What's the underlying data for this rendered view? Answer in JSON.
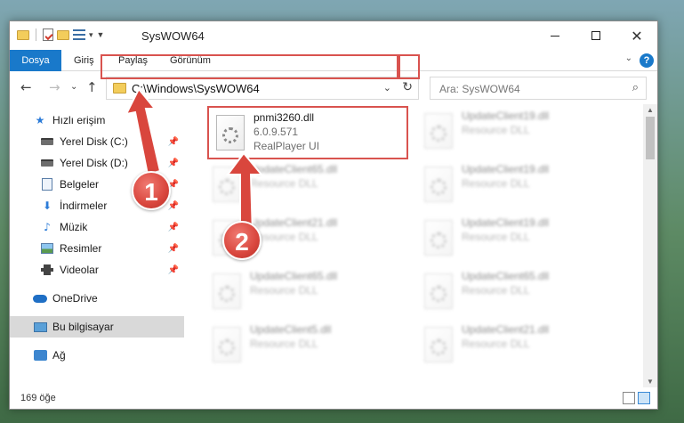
{
  "window": {
    "title": "SysWOW64",
    "controls": {
      "minimize": "—",
      "maximize": "□",
      "close": "✕"
    }
  },
  "ribbon": {
    "tabs": [
      {
        "label": "Dosya",
        "active": true
      },
      {
        "label": "Giriş"
      },
      {
        "label": "Paylaş"
      },
      {
        "label": "Görünüm"
      }
    ],
    "help": "?"
  },
  "nav": {
    "back": "←",
    "forward": "→",
    "dropdown": "⌄",
    "up": "↑",
    "address": "C:\\Windows\\SysWOW64",
    "refresh": "↻",
    "search_placeholder": "Ara: SysWOW64",
    "search_icon": "⌕"
  },
  "sidebar": {
    "items": [
      {
        "label": "Hızlı erişim",
        "icon": "star-icon"
      },
      {
        "label": "Yerel Disk (C:)",
        "icon": "drive-icon",
        "pinned": true
      },
      {
        "label": "Yerel Disk (D:)",
        "icon": "drive-icon",
        "pinned": true
      },
      {
        "label": "Belgeler",
        "icon": "documents-icon",
        "pinned": true
      },
      {
        "label": "İndirmeler",
        "icon": "download-icon",
        "pinned": true
      },
      {
        "label": "Müzik",
        "icon": "music-icon",
        "pinned": true
      },
      {
        "label": "Resimler",
        "icon": "pictures-icon",
        "pinned": true
      },
      {
        "label": "Videolar",
        "icon": "videos-icon",
        "pinned": true
      },
      {
        "label": "OneDrive",
        "icon": "cloud-icon"
      },
      {
        "label": "Bu bilgisayar",
        "icon": "computer-icon",
        "selected": true
      },
      {
        "label": "Ağ",
        "icon": "network-icon"
      }
    ]
  },
  "files": {
    "highlighted": {
      "name": "pnmi3260.dll",
      "version": "6.0.9.571",
      "desc": "RealPlayer UI"
    },
    "left_column": [
      {
        "name": "UpdateClient65.dll",
        "desc": "Resource DLL"
      },
      {
        "name": "UpdateClient21.dll",
        "desc": "Resource DLL"
      },
      {
        "name": "UpdateClient65.dll",
        "desc": "Resource DLL"
      },
      {
        "name": "UpdateClient5.dll",
        "desc": "Resource DLL"
      }
    ],
    "right_column": [
      {
        "name": "UpdateClient19.dll",
        "desc": "Resource DLL"
      },
      {
        "name": "UpdateClient19.dll",
        "desc": "Resource DLL"
      },
      {
        "name": "UpdateClient19.dll",
        "desc": "Resource DLL"
      },
      {
        "name": "UpdateClient65.dll",
        "desc": "Resource DLL"
      },
      {
        "name": "UpdateClient21.dll",
        "desc": "Resource DLL"
      }
    ]
  },
  "status": {
    "count": "169 öğe"
  },
  "annotations": {
    "marker1": "1",
    "marker2": "2",
    "color": "#d9463d"
  }
}
